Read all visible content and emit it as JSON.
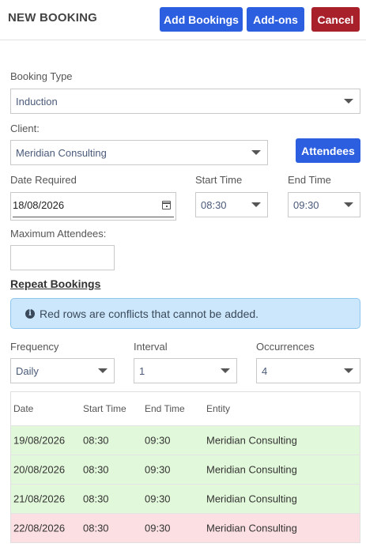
{
  "header": {
    "title": "NEW BOOKING",
    "add_bookings_label": "Add Bookings",
    "addons_label": "Add-ons",
    "cancel_label": "Cancel"
  },
  "booking_type": {
    "label": "Booking Type",
    "value": "Induction"
  },
  "client": {
    "label": "Client:",
    "value": "Meridian Consulting",
    "attendees_label": "Attendees"
  },
  "date_required": {
    "label": "Date Required",
    "value": "18/08/2026"
  },
  "start_time": {
    "label": "Start Time",
    "value": "08:30"
  },
  "end_time": {
    "label": "End Time",
    "value": "09:30"
  },
  "max_attendees": {
    "label": "Maximum Attendees:",
    "value": ""
  },
  "repeat": {
    "heading": "Repeat Bookings",
    "info_text": "Red rows are conflicts that cannot be added.",
    "frequency": {
      "label": "Frequency",
      "value": "Daily"
    },
    "interval": {
      "label": "Interval",
      "value": "1"
    },
    "occurrences": {
      "label": "Occurrences",
      "value": "4"
    }
  },
  "table": {
    "headers": [
      "Date",
      "Start Time",
      "End Time",
      "Entity"
    ],
    "rows": [
      {
        "date": "19/08/2026",
        "start": "08:30",
        "end": "09:30",
        "entity": "Meridian Consulting",
        "status": "ok"
      },
      {
        "date": "20/08/2026",
        "start": "08:30",
        "end": "09:30",
        "entity": "Meridian Consulting",
        "status": "ok"
      },
      {
        "date": "21/08/2026",
        "start": "08:30",
        "end": "09:30",
        "entity": "Meridian Consulting",
        "status": "ok"
      },
      {
        "date": "22/08/2026",
        "start": "08:30",
        "end": "09:30",
        "entity": "Meridian Consulting",
        "status": "conflict"
      }
    ]
  },
  "colors": {
    "primary": "#2c5fe0",
    "danger": "#a8202a",
    "ok_row": "#e2f8da",
    "conflict_row": "#fbdfe2",
    "info_bg": "#cce7fb"
  }
}
